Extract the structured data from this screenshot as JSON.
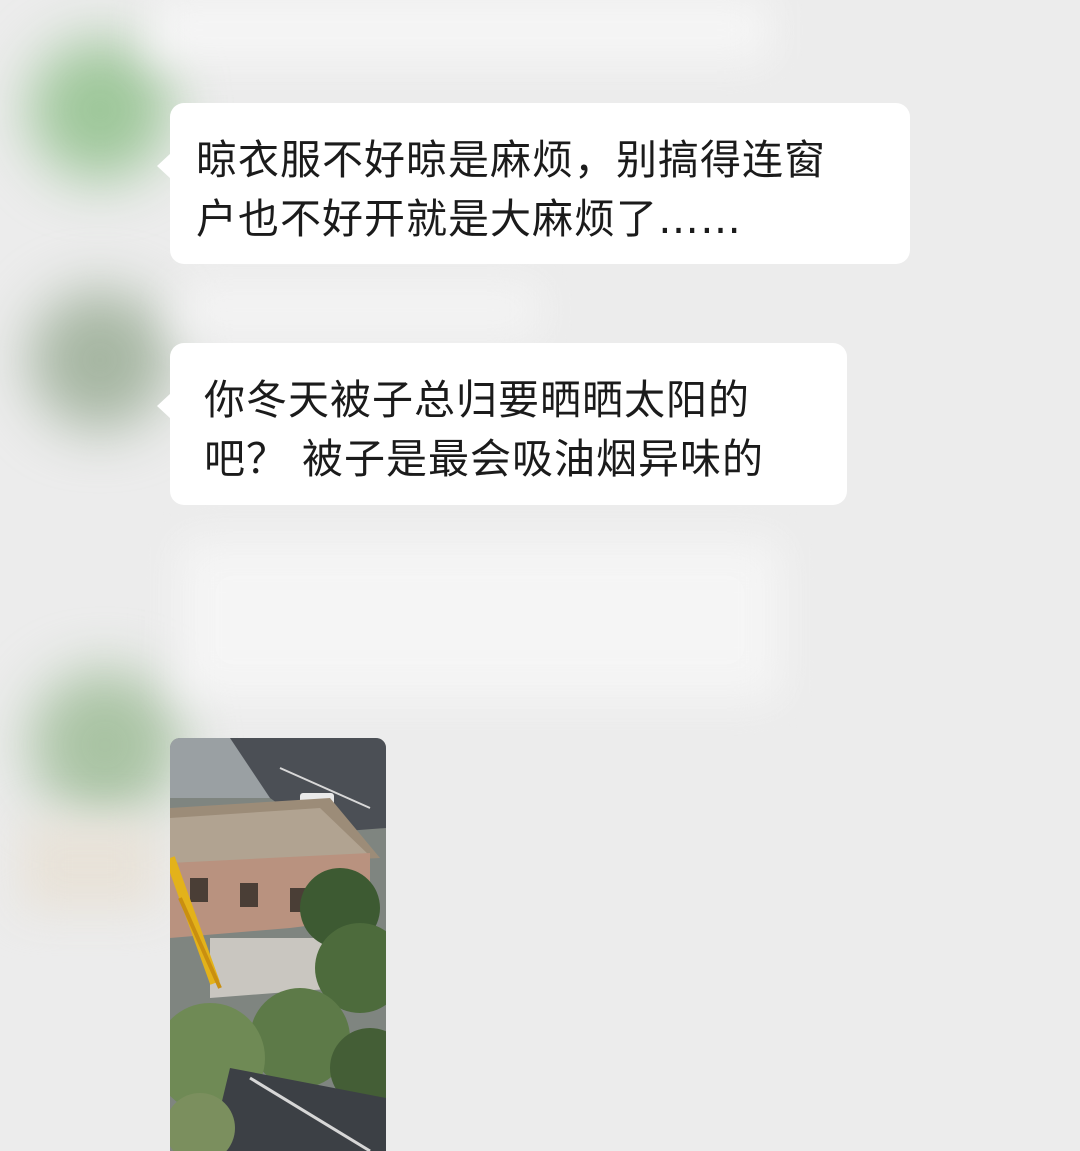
{
  "chat": {
    "messages": [
      {
        "type": "text",
        "lines": [
          "晾衣服不好晾是麻烦，别搞得连窗",
          "户也不好开就是大麻烦了……"
        ]
      },
      {
        "type": "text",
        "lines": [
          "你冬天被子总归要晒晒太阳的",
          "吧？ 被子是最会吸油烟异味的"
        ]
      },
      {
        "type": "image",
        "description_icon": "photo-thumbnail"
      }
    ]
  },
  "colors": {
    "background": "#ececec",
    "bubble": "#ffffff",
    "text": "#1b1b1b"
  }
}
